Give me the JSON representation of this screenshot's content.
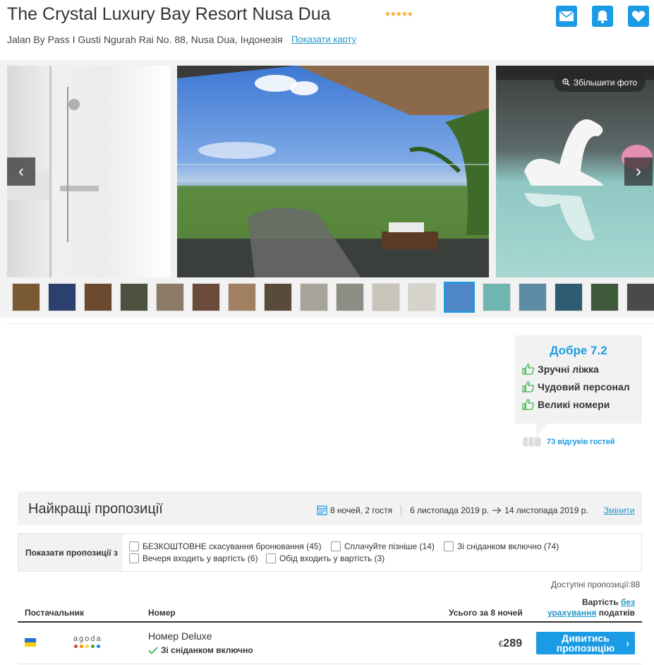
{
  "hotel": {
    "name": "The Crystal Luxury Bay Resort Nusa Dua",
    "stars": "★★★★★",
    "address": "Jalan By Pass I Gusti Ngurah Rai No. 88, Nusa Dua, Індонезія",
    "map_link": "Показати карту"
  },
  "gallery": {
    "zoom_label": "Збільшити фото",
    "thumb_count": 18,
    "active_thumb": 12
  },
  "reviews": {
    "rating": "Добре 7.2",
    "items": [
      "Зручні ліжка",
      "Чудовий персонал",
      "Великі номери"
    ],
    "count_label": "73 відгуків гостей"
  },
  "offers": {
    "title": "Найкращі пропозиції",
    "stay": "8 ночей, 2 гостя",
    "checkin": "6 листопада 2019 р.",
    "checkout": "14 листопада 2019 р.",
    "change": "Змінити",
    "filter_label": "Показати пропозиції з",
    "filters": [
      "БЕЗКОШТОВНЕ скасування бронювання (45)",
      "Сплачуйте пізніше (14)",
      "Зі сніданком включно (74)",
      "Вечеря входить у вартість (6)",
      "Обід входить у вартість (3)"
    ],
    "available": "Доступні пропозиції:88",
    "columns": {
      "provider": "Постачальник",
      "room": "Номер",
      "total": "Усього за 8 ночей",
      "cost": "Вартість",
      "without": "без",
      "tax_link": "урахування",
      "taxes": "податків"
    },
    "rows": [
      {
        "provider": "agoda",
        "room": "Номер Deluxe",
        "feature": "Зі сніданком включно",
        "currency": "€",
        "price": "289",
        "button": "Дивитись пропозицію"
      }
    ]
  },
  "colors": {
    "accent": "#1a9be4",
    "link": "#2196c9",
    "stars": "#f5a623",
    "thumb_good": "#3bb54a"
  }
}
